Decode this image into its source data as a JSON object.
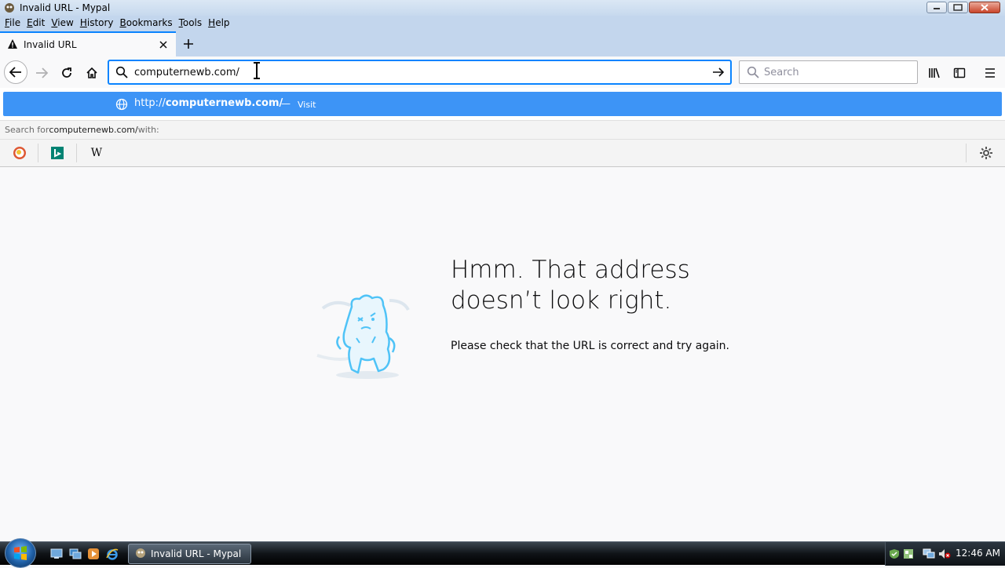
{
  "window": {
    "title": "Invalid URL - Mypal"
  },
  "menu": [
    {
      "label": "File",
      "accel": "F",
      "rest": "ile"
    },
    {
      "label": "Edit",
      "accel": "E",
      "rest": "dit"
    },
    {
      "label": "View",
      "accel": "V",
      "rest": "iew"
    },
    {
      "label": "History",
      "accel": "H",
      "rest": "istory"
    },
    {
      "label": "Bookmarks",
      "accel": "B",
      "rest": "ookmarks"
    },
    {
      "label": "Tools",
      "accel": "T",
      "rest": "ools"
    },
    {
      "label": "Help",
      "accel": "H",
      "rest": "elp"
    }
  ],
  "tab": {
    "label": "Invalid URL",
    "icon": "warning-icon"
  },
  "urlbar": {
    "value": "computernewb.com/"
  },
  "searchbar": {
    "placeholder": "Search"
  },
  "popup": {
    "url_prefix": "http://",
    "url_bold": "computernewb.com/",
    "separator": "—",
    "action": "Visit",
    "search_with_prefix": "Search for ",
    "search_with_query": "computernewb.com/",
    "search_with_suffix": " with:",
    "engines": [
      "duckduckgo-icon",
      "bing-icon",
      "wikipedia-icon"
    ],
    "wikipedia_glyph": "W"
  },
  "error": {
    "title": "Hmm. That address doesn’t look right.",
    "description": "Please check that the URL is correct and try again."
  },
  "taskbar": {
    "task_label": "Invalid URL - Mypal",
    "clock": "12:46 AM"
  },
  "colors": {
    "accent": "#0a84ff",
    "popup_highlight": "#3d94f6",
    "illustration": "#4fc3f7"
  }
}
